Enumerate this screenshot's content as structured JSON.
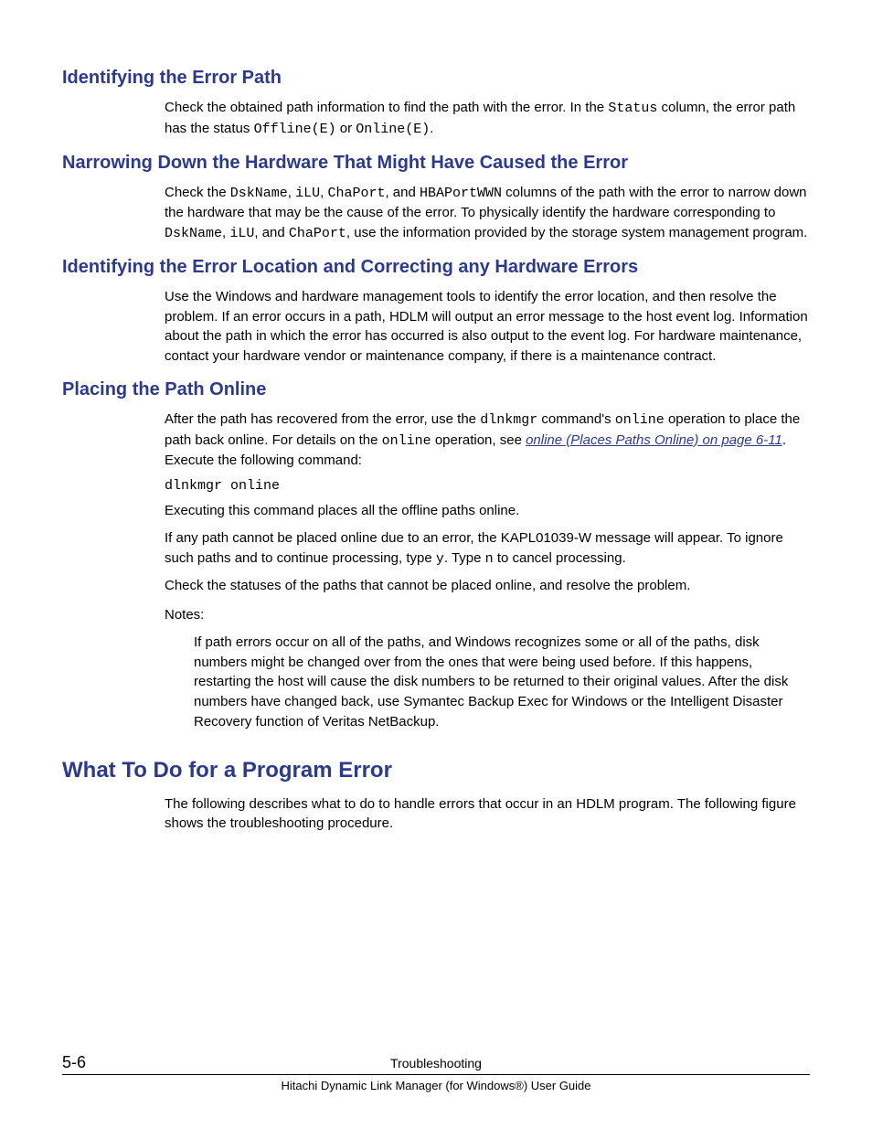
{
  "sections": {
    "s1": {
      "heading": "Identifying the Error Path",
      "p1_a": "Check the obtained path information to find the path with the error. In the ",
      "p1_code1": "Status",
      "p1_b": " column, the error path has the status ",
      "p1_code2": "Offline(E)",
      "p1_c": " or ",
      "p1_code3": "Online(E)",
      "p1_d": "."
    },
    "s2": {
      "heading": "Narrowing Down the Hardware That Might Have Caused the Error",
      "p1_a": "Check the ",
      "p1_code1": "DskName",
      "p1_b": ", ",
      "p1_code2": "iLU",
      "p1_c": ", ",
      "p1_code3": "ChaPort",
      "p1_d": ", and ",
      "p1_code4": "HBAPortWWN",
      "p1_e": " columns of the path with the error to narrow down the hardware that may be the cause of the error. To physically identify the hardware corresponding to ",
      "p1_code5": "DskName",
      "p1_f": ", ",
      "p1_code6": "iLU",
      "p1_g": ", and ",
      "p1_code7": "ChaPort",
      "p1_h": ", use the information provided by the storage system management program."
    },
    "s3": {
      "heading": "Identifying the Error Location and Correcting any Hardware Errors",
      "p1": "Use the Windows and hardware management tools to identify the error location, and then resolve the problem. If an error occurs in a path, HDLM will output an error message to the host event log. Information about the path in which the error has occurred is also output to the event log. For hardware maintenance, contact your hardware vendor or maintenance company, if there is a maintenance contract."
    },
    "s4": {
      "heading": "Placing the Path Online",
      "p1_a": "After the path has recovered from the error, use the ",
      "p1_code1": "dlnkmgr",
      "p1_b": " command's ",
      "p1_code2": "online",
      "p1_c": " operation to place the path back online. For details on the ",
      "p1_code3": "online",
      "p1_d": " operation, see ",
      "p1_link": "online (Places Paths Online) on page 6-11",
      "p1_e": ". Execute the following command:",
      "cmd": "dlnkmgr online",
      "p2": "Executing this command places all the offline paths online.",
      "p3_a": "If any path cannot be placed online due to an error, the KAPL01039-W message will appear. To ignore such paths and to continue processing, type ",
      "p3_code1": "y",
      "p3_b": ". Type ",
      "p3_code2": "n",
      "p3_c": " to cancel processing.",
      "p4": "Check the statuses of the paths that cannot be placed online, and resolve the problem.",
      "notes_label": "Notes:",
      "notes_body": "If path errors occur on all of the paths, and Windows recognizes some or all of the paths, disk numbers might be changed over from the ones that were being used before. If this happens, restarting the host will cause the disk numbers to be returned to their original values. After the disk numbers have changed back, use Symantec Backup Exec for Windows or the Intelligent Disaster Recovery function of Veritas NetBackup."
    },
    "s5": {
      "heading": "What To Do for a Program Error",
      "p1": "The following describes what to do to handle errors that occur in an HDLM program. The following figure shows the troubleshooting procedure."
    }
  },
  "footer": {
    "page_num": "5-6",
    "title": "Troubleshooting",
    "subtitle": "Hitachi Dynamic Link Manager (for Windows®) User Guide"
  }
}
